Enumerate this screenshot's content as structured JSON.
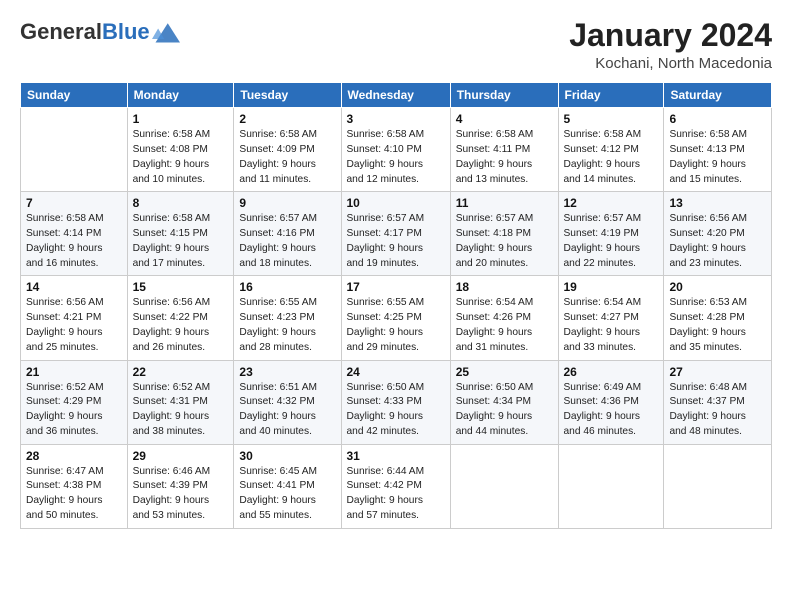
{
  "header": {
    "logo_line1": "General",
    "logo_line2": "Blue",
    "month_year": "January 2024",
    "location": "Kochani, North Macedonia"
  },
  "weekdays": [
    "Sunday",
    "Monday",
    "Tuesday",
    "Wednesday",
    "Thursday",
    "Friday",
    "Saturday"
  ],
  "weeks": [
    [
      {
        "day": "",
        "info": ""
      },
      {
        "day": "1",
        "info": "Sunrise: 6:58 AM\nSunset: 4:08 PM\nDaylight: 9 hours\nand 10 minutes."
      },
      {
        "day": "2",
        "info": "Sunrise: 6:58 AM\nSunset: 4:09 PM\nDaylight: 9 hours\nand 11 minutes."
      },
      {
        "day": "3",
        "info": "Sunrise: 6:58 AM\nSunset: 4:10 PM\nDaylight: 9 hours\nand 12 minutes."
      },
      {
        "day": "4",
        "info": "Sunrise: 6:58 AM\nSunset: 4:11 PM\nDaylight: 9 hours\nand 13 minutes."
      },
      {
        "day": "5",
        "info": "Sunrise: 6:58 AM\nSunset: 4:12 PM\nDaylight: 9 hours\nand 14 minutes."
      },
      {
        "day": "6",
        "info": "Sunrise: 6:58 AM\nSunset: 4:13 PM\nDaylight: 9 hours\nand 15 minutes."
      }
    ],
    [
      {
        "day": "7",
        "info": "Sunrise: 6:58 AM\nSunset: 4:14 PM\nDaylight: 9 hours\nand 16 minutes."
      },
      {
        "day": "8",
        "info": "Sunrise: 6:58 AM\nSunset: 4:15 PM\nDaylight: 9 hours\nand 17 minutes."
      },
      {
        "day": "9",
        "info": "Sunrise: 6:57 AM\nSunset: 4:16 PM\nDaylight: 9 hours\nand 18 minutes."
      },
      {
        "day": "10",
        "info": "Sunrise: 6:57 AM\nSunset: 4:17 PM\nDaylight: 9 hours\nand 19 minutes."
      },
      {
        "day": "11",
        "info": "Sunrise: 6:57 AM\nSunset: 4:18 PM\nDaylight: 9 hours\nand 20 minutes."
      },
      {
        "day": "12",
        "info": "Sunrise: 6:57 AM\nSunset: 4:19 PM\nDaylight: 9 hours\nand 22 minutes."
      },
      {
        "day": "13",
        "info": "Sunrise: 6:56 AM\nSunset: 4:20 PM\nDaylight: 9 hours\nand 23 minutes."
      }
    ],
    [
      {
        "day": "14",
        "info": "Sunrise: 6:56 AM\nSunset: 4:21 PM\nDaylight: 9 hours\nand 25 minutes."
      },
      {
        "day": "15",
        "info": "Sunrise: 6:56 AM\nSunset: 4:22 PM\nDaylight: 9 hours\nand 26 minutes."
      },
      {
        "day": "16",
        "info": "Sunrise: 6:55 AM\nSunset: 4:23 PM\nDaylight: 9 hours\nand 28 minutes."
      },
      {
        "day": "17",
        "info": "Sunrise: 6:55 AM\nSunset: 4:25 PM\nDaylight: 9 hours\nand 29 minutes."
      },
      {
        "day": "18",
        "info": "Sunrise: 6:54 AM\nSunset: 4:26 PM\nDaylight: 9 hours\nand 31 minutes."
      },
      {
        "day": "19",
        "info": "Sunrise: 6:54 AM\nSunset: 4:27 PM\nDaylight: 9 hours\nand 33 minutes."
      },
      {
        "day": "20",
        "info": "Sunrise: 6:53 AM\nSunset: 4:28 PM\nDaylight: 9 hours\nand 35 minutes."
      }
    ],
    [
      {
        "day": "21",
        "info": "Sunrise: 6:52 AM\nSunset: 4:29 PM\nDaylight: 9 hours\nand 36 minutes."
      },
      {
        "day": "22",
        "info": "Sunrise: 6:52 AM\nSunset: 4:31 PM\nDaylight: 9 hours\nand 38 minutes."
      },
      {
        "day": "23",
        "info": "Sunrise: 6:51 AM\nSunset: 4:32 PM\nDaylight: 9 hours\nand 40 minutes."
      },
      {
        "day": "24",
        "info": "Sunrise: 6:50 AM\nSunset: 4:33 PM\nDaylight: 9 hours\nand 42 minutes."
      },
      {
        "day": "25",
        "info": "Sunrise: 6:50 AM\nSunset: 4:34 PM\nDaylight: 9 hours\nand 44 minutes."
      },
      {
        "day": "26",
        "info": "Sunrise: 6:49 AM\nSunset: 4:36 PM\nDaylight: 9 hours\nand 46 minutes."
      },
      {
        "day": "27",
        "info": "Sunrise: 6:48 AM\nSunset: 4:37 PM\nDaylight: 9 hours\nand 48 minutes."
      }
    ],
    [
      {
        "day": "28",
        "info": "Sunrise: 6:47 AM\nSunset: 4:38 PM\nDaylight: 9 hours\nand 50 minutes."
      },
      {
        "day": "29",
        "info": "Sunrise: 6:46 AM\nSunset: 4:39 PM\nDaylight: 9 hours\nand 53 minutes."
      },
      {
        "day": "30",
        "info": "Sunrise: 6:45 AM\nSunset: 4:41 PM\nDaylight: 9 hours\nand 55 minutes."
      },
      {
        "day": "31",
        "info": "Sunrise: 6:44 AM\nSunset: 4:42 PM\nDaylight: 9 hours\nand 57 minutes."
      },
      {
        "day": "",
        "info": ""
      },
      {
        "day": "",
        "info": ""
      },
      {
        "day": "",
        "info": ""
      }
    ]
  ]
}
